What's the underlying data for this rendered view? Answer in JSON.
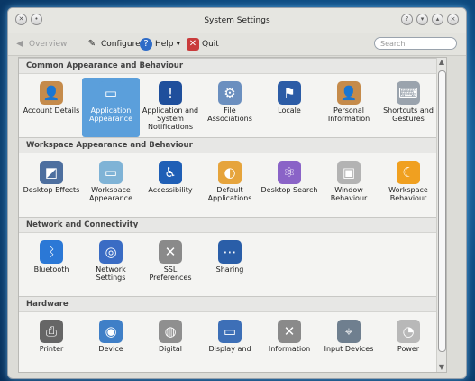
{
  "window": {
    "title": "System Settings"
  },
  "toolbar": {
    "overview": "Overview",
    "configure": "Configure",
    "help": "Help",
    "quit": "Quit",
    "search_placeholder": "Search"
  },
  "sections": [
    {
      "title": "Common Appearance and Behaviour",
      "items": [
        {
          "label": "Account Details",
          "icon": "user-info-icon",
          "color": "#c58b4b"
        },
        {
          "label": "Application Appearance",
          "icon": "paint-icon",
          "color": "#5b9fdb",
          "selected": true
        },
        {
          "label": "Application and System Notifications",
          "icon": "exclamation-icon",
          "color": "#1f4f9c"
        },
        {
          "label": "File Associations",
          "icon": "gears-icon",
          "color": "#6b8fbf"
        },
        {
          "label": "Locale",
          "icon": "flag-icon",
          "color": "#2c5ca6"
        },
        {
          "label": "Personal Information",
          "icon": "user-info-icon",
          "color": "#c58b4b"
        },
        {
          "label": "Shortcuts and Gestures",
          "icon": "keyboard-icon",
          "color": "#9aa3ad"
        }
      ]
    },
    {
      "title": "Workspace Appearance and Behaviour",
      "items": [
        {
          "label": "Desktop Effects",
          "icon": "desktop-effects-icon",
          "color": "#4d6f9f"
        },
        {
          "label": "Workspace Appearance",
          "icon": "paint-icon",
          "color": "#7fb3d6"
        },
        {
          "label": "Accessibility",
          "icon": "accessibility-icon",
          "color": "#1f5fb6"
        },
        {
          "label": "Default Applications",
          "icon": "default-apps-icon",
          "color": "#e6a43c"
        },
        {
          "label": "Desktop Search",
          "icon": "molecule-icon",
          "color": "#8a63c7"
        },
        {
          "label": "Window Behaviour",
          "icon": "window-icon",
          "color": "#b3b3b3"
        },
        {
          "label": "Workspace Behaviour",
          "icon": "moon-icon",
          "color": "#f0a020"
        }
      ]
    },
    {
      "title": "Network and Connectivity",
      "items": [
        {
          "label": "Bluetooth",
          "icon": "bluetooth-icon",
          "color": "#2b78d6"
        },
        {
          "label": "Network Settings",
          "icon": "globe-icon",
          "color": "#3a6cc4"
        },
        {
          "label": "SSL Preferences",
          "icon": "tools-icon",
          "color": "#8a8a8a"
        },
        {
          "label": "Sharing",
          "icon": "sharing-icon",
          "color": "#2a5ea8"
        }
      ]
    },
    {
      "title": "Hardware",
      "items": [
        {
          "label": "Printer",
          "icon": "printer-icon",
          "color": "#666666"
        },
        {
          "label": "Device",
          "icon": "cd-icon",
          "color": "#3f7fc7"
        },
        {
          "label": "Digital",
          "icon": "camera-icon",
          "color": "#8f8f8f"
        },
        {
          "label": "Display and",
          "icon": "monitor-icon",
          "color": "#3d6fb7"
        },
        {
          "label": "Information",
          "icon": "tools-icon",
          "color": "#8a8a8a"
        },
        {
          "label": "Input Devices",
          "icon": "input-devices-icon",
          "color": "#6f7f8f"
        },
        {
          "label": "Power",
          "icon": "bulb-icon",
          "color": "#b8b8b8"
        }
      ]
    }
  ]
}
